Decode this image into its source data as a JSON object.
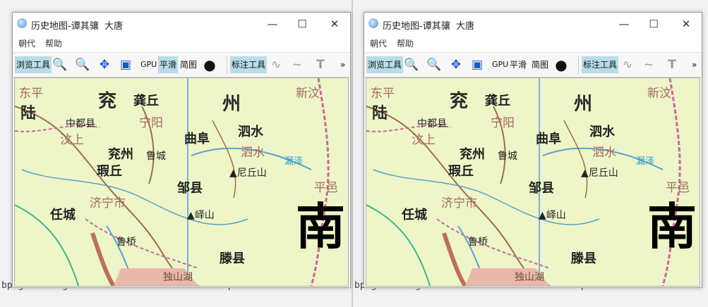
{
  "background": {
    "left_lines": [
      "bpng warning: iCCP: known incorrect sRGB profile"
    ],
    "right_lines": [
      "bpng warning: iCCP: known incorrect sRGB profile"
    ]
  },
  "windows": [
    {
      "title": "历史地图-谭其骧  大唐",
      "menu": [
        "朝代",
        "帮助"
      ],
      "toolbar": {
        "browse_tools": "浏览工具",
        "gpu": "GPU",
        "smooth": "平滑",
        "simple": "简图",
        "annotate_tools": "标注工具",
        "overflow": "»"
      },
      "map_labels": {
        "yan": "兖",
        "gong_qiu": "龚丘",
        "zhou": "州",
        "xin_wen": "新汶",
        "zhong_du": "中都县",
        "ning_yang": "宁阳",
        "wen_shang": "汶上",
        "qu_fu": "曲阜",
        "si_shui": "泗水",
        "yan_zhou": "兖州",
        "lu_cheng": "鲁城",
        "si_shui2": "泗水",
        "xia_qiu": "瑕丘",
        "ni_qiu_shan": "▲尼丘山",
        "lou_ze": "漏泽",
        "zou_xian": "邹县",
        "ping_yi": "平邑",
        "ji_ning": "济宁市",
        "ren_cheng": "任城",
        "yi_shan": "▲峄山",
        "lu_qiao": "鲁桥",
        "teng_xian": "滕县",
        "du_shan_hu": "独山湖",
        "nan": "南",
        "jiang_ping": "东平",
        "lu_": "陆",
        "shui": "水"
      }
    }
  ]
}
